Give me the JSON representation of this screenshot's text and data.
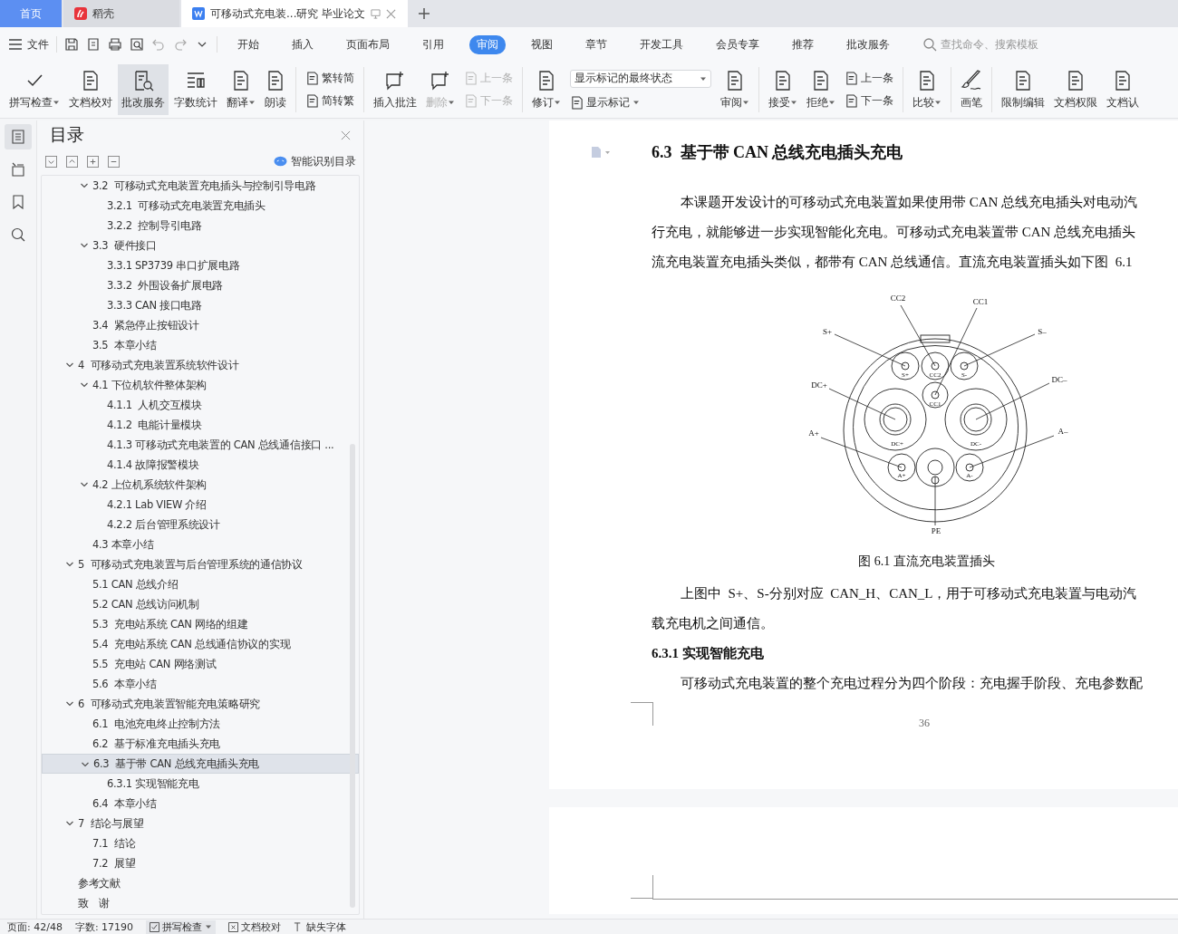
{
  "tabs": [
    {
      "kind": "home",
      "label": "首页",
      "selected": false
    },
    {
      "kind": "app",
      "label": "稻壳",
      "selected": false
    },
    {
      "kind": "doc",
      "label": "可移动式充电装...研究 毕业论文",
      "selected": true
    }
  ],
  "menu": {
    "file": "文件",
    "tabs": [
      {
        "label": "开始",
        "selected": false
      },
      {
        "label": "插入",
        "selected": false
      },
      {
        "label": "页面布局",
        "selected": false
      },
      {
        "label": "引用",
        "selected": false
      },
      {
        "label": "审阅",
        "selected": true
      },
      {
        "label": "视图",
        "selected": false
      },
      {
        "label": "章节",
        "selected": false
      },
      {
        "label": "开发工具",
        "selected": false
      },
      {
        "label": "会员专享",
        "selected": false
      },
      {
        "label": "推荐",
        "selected": false
      },
      {
        "label": "批改服务",
        "selected": false
      }
    ],
    "search": {
      "placeholder": "查找命令、搜索模板"
    }
  },
  "ribbon": {
    "groups": [
      {
        "items": [
          {
            "kind": "big",
            "label": "拼写检查",
            "dropdown": true,
            "disabled": false,
            "selected": false
          },
          {
            "kind": "big",
            "label": "文档校对",
            "dropdown": false,
            "disabled": false,
            "selected": false
          },
          {
            "kind": "big",
            "label": "批改服务",
            "dropdown": false,
            "disabled": false,
            "selected": true
          },
          {
            "kind": "big",
            "label": "字数统计",
            "dropdown": false,
            "disabled": false,
            "selected": false
          },
          {
            "kind": "big",
            "label": "翻译",
            "dropdown": true,
            "disabled": false,
            "selected": false
          },
          {
            "kind": "big",
            "label": "朗读",
            "dropdown": false,
            "disabled": false,
            "selected": false
          }
        ]
      },
      {
        "items": [
          {
            "kind": "pair",
            "rows": [
              {
                "label": "繁转简",
                "dropdown": false,
                "disabled": false
              },
              {
                "label": "简转繁",
                "dropdown": false,
                "disabled": false
              }
            ]
          }
        ]
      },
      {
        "items": [
          {
            "kind": "big",
            "label": "插入批注",
            "dropdown": false,
            "disabled": false,
            "selected": false
          },
          {
            "kind": "big",
            "label": "删除",
            "dropdown": true,
            "disabled": true,
            "selected": false
          },
          {
            "kind": "pair",
            "rows": [
              {
                "label": "上一条",
                "dropdown": false,
                "disabled": true
              },
              {
                "label": "下一条",
                "dropdown": false,
                "disabled": true
              }
            ]
          }
        ]
      },
      {
        "items": [
          {
            "kind": "big",
            "label": "修订",
            "dropdown": true,
            "disabled": false,
            "selected": false
          },
          {
            "kind": "select",
            "value": "显示标记的最终状态",
            "rows": [
              {
                "label": "显示标记",
                "dropdown": true,
                "disabled": false
              }
            ]
          },
          {
            "kind": "big",
            "label": "审阅",
            "dropdown": true,
            "disabled": false,
            "selected": false
          }
        ]
      },
      {
        "items": [
          {
            "kind": "big",
            "label": "接受",
            "dropdown": true,
            "disabled": false,
            "selected": false
          },
          {
            "kind": "big",
            "label": "拒绝",
            "dropdown": true,
            "disabled": false,
            "selected": false
          },
          {
            "kind": "pair",
            "rows": [
              {
                "label": "上一条",
                "dropdown": false,
                "disabled": false
              },
              {
                "label": "下一条",
                "dropdown": false,
                "disabled": false
              }
            ]
          }
        ]
      },
      {
        "items": [
          {
            "kind": "big",
            "label": "比较",
            "dropdown": true,
            "disabled": false,
            "selected": false
          }
        ]
      },
      {
        "items": [
          {
            "kind": "big",
            "label": "画笔",
            "dropdown": false,
            "disabled": false,
            "selected": false
          }
        ]
      },
      {
        "items": [
          {
            "kind": "big",
            "label": "限制编辑",
            "dropdown": false,
            "disabled": false,
            "selected": false
          },
          {
            "kind": "big",
            "label": "文档权限",
            "dropdown": false,
            "disabled": false,
            "selected": false
          },
          {
            "kind": "big",
            "label": "文档认",
            "dropdown": false,
            "disabled": false,
            "selected": false
          }
        ]
      }
    ]
  },
  "nav_strip": [
    {
      "selected": true
    },
    {
      "selected": false
    },
    {
      "selected": false
    },
    {
      "selected": false
    }
  ],
  "toc": {
    "title": "目录",
    "smart": "智能识别目录",
    "items": [
      {
        "children": [
          {
            "label": "3.2  可移动式充电装置充电插头与控制引导电路",
            "selected": false,
            "expanded": true,
            "children": [
              {
                "label": "3.2.1  可移动式充电装置充电插头",
                "selected": false
              },
              {
                "label": "3.2.2  控制导引电路",
                "selected": false
              }
            ]
          },
          {
            "label": "3.3  硬件接口",
            "selected": false,
            "expanded": true,
            "children": [
              {
                "label": "3.3.1 SP3739 串口扩展电路",
                "selected": false
              },
              {
                "label": "3.3.2  外围设备扩展电路",
                "selected": false
              },
              {
                "label": "3.3.3 CAN 接口电路",
                "selected": false
              }
            ]
          },
          {
            "label": "3.4  紧急停止按钮设计",
            "selected": false
          },
          {
            "label": "3.5  本章小结",
            "selected": false
          }
        ]
      },
      {
        "label": "4  可移动式充电装置系统软件设计",
        "selected": false,
        "expanded": true,
        "children": [
          {
            "label": "4.1 下位机软件整体架构",
            "selected": false,
            "expanded": true,
            "children": [
              {
                "label": "4.1.1  人机交互模块",
                "selected": false
              },
              {
                "label": "4.1.2  电能计量模块",
                "selected": false
              },
              {
                "label": "4.1.3 可移动式充电装置的 CAN 总线通信接口 ...",
                "selected": false
              },
              {
                "label": "4.1.4 故障报警模块",
                "selected": false
              }
            ]
          },
          {
            "label": "4.2 上位机系统软件架构",
            "selected": false,
            "expanded": true,
            "children": [
              {
                "label": "4.2.1 Lab VIEW 介绍",
                "selected": false
              },
              {
                "label": "4.2.2 后台管理系统设计",
                "selected": false
              }
            ]
          },
          {
            "label": "4.3 本章小结",
            "selected": false
          }
        ]
      },
      {
        "label": "5  可移动式充电装置与后台管理系统的通信协议",
        "selected": false,
        "expanded": true,
        "children": [
          {
            "label": "5.1 CAN 总线介绍",
            "selected": false
          },
          {
            "label": "5.2 CAN 总线访问机制",
            "selected": false
          },
          {
            "label": "5.3  充电站系统 CAN 网络的组建",
            "selected": false
          },
          {
            "label": "5.4  充电站系统 CAN 总线通信协议的实现",
            "selected": false
          },
          {
            "label": "5.5  充电站 CAN 网络测试",
            "selected": false
          },
          {
            "label": "5.6  本章小结",
            "selected": false
          }
        ]
      },
      {
        "label": "6  可移动式充电装置智能充电策略研究",
        "selected": false,
        "expanded": true,
        "children": [
          {
            "label": "6.1  电池充电终止控制方法",
            "selected": false
          },
          {
            "label": "6.2  基于标准充电插头充电",
            "selected": false
          },
          {
            "label": "6.3  基于带 CAN 总线充电插头充电",
            "selected": true,
            "expanded": true,
            "children": [
              {
                "label": "6.3.1 实现智能充电",
                "selected": false
              }
            ]
          },
          {
            "label": "6.4  本章小结",
            "selected": false
          }
        ]
      },
      {
        "label": "7  结论与展望",
        "selected": false,
        "expanded": true,
        "children": [
          {
            "label": "7.1  结论",
            "selected": false
          },
          {
            "label": "7.2  展望",
            "selected": false
          }
        ]
      },
      {
        "label": "参考文献",
        "selected": false
      },
      {
        "label": "致　谢",
        "selected": false
      }
    ]
  },
  "document": {
    "page_number": "36",
    "blocks": [
      {
        "kind": "heading",
        "text": "6.3  基于带 CAN 总线充电插头充电"
      },
      {
        "kind": "para",
        "lines": [
          "本课题开发设计的可移动式充电装置如果使用带 CAN 总线充电插头对电动汽",
          "行充电，就能够进一步实现智能化充电。可移动式充电装置带 CAN 总线充电插头",
          "流充电装置充电插头类似，都带有 CAN 总线通信。直流充电装置插头如下图  6.1"
        ]
      },
      {
        "kind": "figure",
        "labels": [
          "CC2",
          "CC1",
          "S+",
          "S–",
          "DC+",
          "DC–",
          "A+",
          "A–",
          "PE"
        ],
        "pin_labels": [
          "S+",
          "CC2",
          "S-",
          "CC1",
          "DC+",
          "DC-",
          "A+",
          "A-"
        ]
      },
      {
        "kind": "caption",
        "text": "图 6.1 直流充电装置插头"
      },
      {
        "kind": "para",
        "lines": [
          "上图中  S+、S-分别对应  CAN_H、CAN_L，用于可移动式充电装置与电动汽",
          "载充电机之间通信。"
        ]
      },
      {
        "kind": "subheading",
        "text": "6.3.1 实现智能充电"
      },
      {
        "kind": "para",
        "lines": [
          "可移动式充电装置的整个充电过程分为四个阶段：充电握手阶段、充电参数配"
        ]
      }
    ]
  },
  "status_bar": [
    {
      "kind": "text",
      "label": "页面: 42/48"
    },
    {
      "kind": "text",
      "label": "字数: 17190"
    },
    {
      "kind": "check",
      "label": "拼写检查",
      "selected": true
    },
    {
      "kind": "cross",
      "label": "文档校对",
      "selected": false
    },
    {
      "kind": "font",
      "label": "缺失字体",
      "selected": false
    }
  ]
}
